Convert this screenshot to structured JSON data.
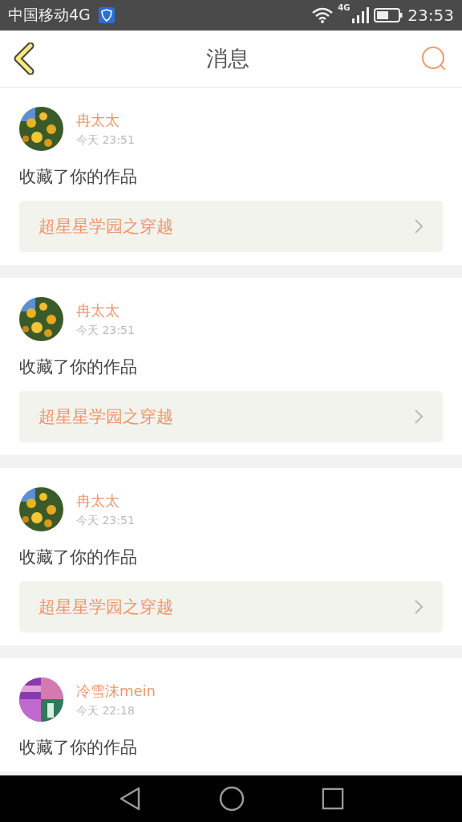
{
  "status_bar": {
    "carrier": "中国移动4G",
    "network": "4G",
    "time": "23:53"
  },
  "header": {
    "title": "消息"
  },
  "messages": [
    {
      "user": "冉太太",
      "time": "今天 23:51",
      "text": "收藏了你的作品",
      "work": "超星星学园之穿越"
    },
    {
      "user": "冉太太",
      "time": "今天 23:51",
      "text": "收藏了你的作品",
      "work": "超星星学园之穿越"
    },
    {
      "user": "冉太太",
      "time": "今天 23:51",
      "text": "收藏了你的作品",
      "work": "超星星学园之穿越"
    },
    {
      "user": "冷雪沫mein",
      "time": "今天 22:18",
      "text": "收藏了你的作品"
    }
  ]
}
